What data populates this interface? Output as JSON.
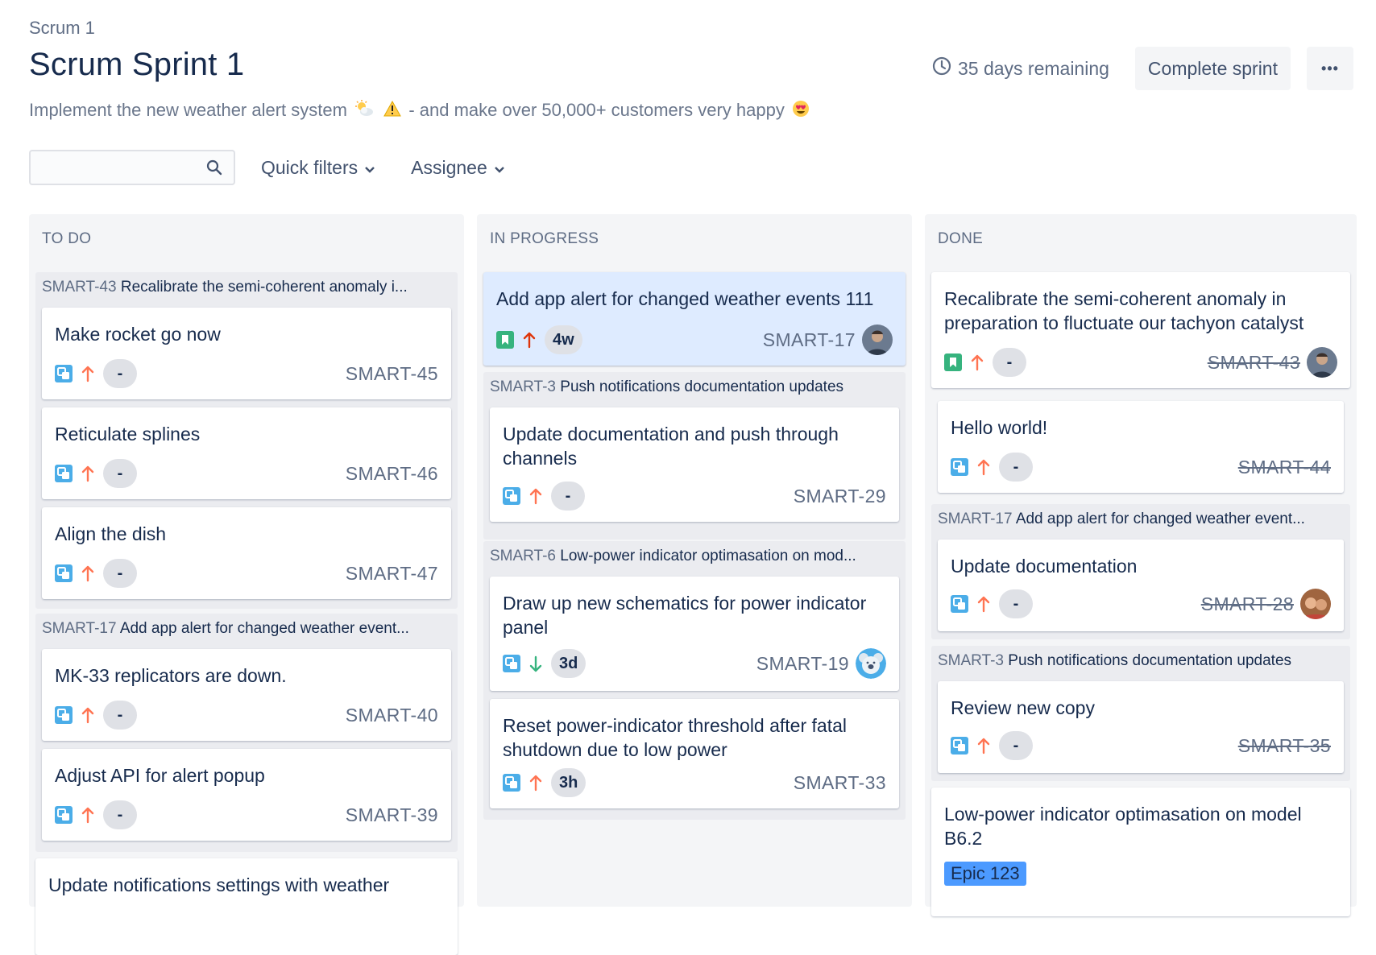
{
  "breadcrumb": "Scrum 1",
  "title": "Scrum Sprint 1",
  "goal": {
    "text_before": "Implement the new weather alert system",
    "text_after": "- and make over 50,000+ customers very happy"
  },
  "header": {
    "days_remaining": "35 days remaining",
    "complete_label": "Complete sprint",
    "more_label": "•••"
  },
  "toolbar": {
    "search_placeholder": "",
    "quick_filters": "Quick filters",
    "assignee": "Assignee"
  },
  "colors": {
    "accent": "#0052cc",
    "story": "#36b37e",
    "task": "#4bade8",
    "high": "#ff7452",
    "highest": "#de350b",
    "low": "#36b37e",
    "selected": "#deebff"
  },
  "columns": {
    "todo": {
      "title": "TO DO",
      "swim1": {
        "key": "SMART-43",
        "summary": "Recalibrate the semi-coherent anomaly i..."
      },
      "c1": {
        "summary": "Make rocket go now",
        "estimate": "-",
        "key": "SMART-45"
      },
      "c2": {
        "summary": "Reticulate splines",
        "estimate": "-",
        "key": "SMART-46"
      },
      "c3": {
        "summary": "Align the dish",
        "estimate": "-",
        "key": "SMART-47"
      },
      "swim2": {
        "key": "SMART-17",
        "summary": "Add app alert for changed weather event..."
      },
      "c4": {
        "summary": "MK-33 replicators are down.",
        "estimate": "-",
        "key": "SMART-40"
      },
      "c5": {
        "summary": "Adjust API for alert popup",
        "estimate": "-",
        "key": "SMART-39"
      },
      "c6": {
        "summary": "Update notifications settings with weather"
      }
    },
    "inprogress": {
      "title": "IN PROGRESS",
      "c1": {
        "summary": "Add app alert for changed weather events 111",
        "estimate": "4w",
        "key": "SMART-17"
      },
      "swim1": {
        "key": "SMART-3",
        "summary": "Push notifications documentation updates"
      },
      "c2": {
        "summary": "Update documentation and push through channels",
        "estimate": "-",
        "key": "SMART-29"
      },
      "swim2": {
        "key": "SMART-6",
        "summary": "Low-power indicator optimasation on mod..."
      },
      "c3": {
        "summary": "Draw up new schematics for power indicator panel",
        "estimate": "3d",
        "key": "SMART-19"
      },
      "c4": {
        "summary": "Reset power-indicator threshold after fatal shutdown due to low power",
        "estimate": "3h",
        "key": "SMART-33"
      }
    },
    "done": {
      "title": "DONE",
      "c1": {
        "summary": "Recalibrate the semi-coherent anomaly in preparation to fluctuate our tachyon catalyst",
        "estimate": "-",
        "key": "SMART-43"
      },
      "c2": {
        "summary": "Hello world!",
        "estimate": "-",
        "key": "SMART-44"
      },
      "swim1": {
        "key": "SMART-17",
        "summary": "Add app alert for changed weather event..."
      },
      "c3": {
        "summary": "Update documentation",
        "estimate": "-",
        "key": "SMART-28"
      },
      "swim2": {
        "key": "SMART-3",
        "summary": "Push notifications documentation updates"
      },
      "c4": {
        "summary": "Review new copy",
        "estimate": "-",
        "key": "SMART-35"
      },
      "c5": {
        "summary": "Low-power indicator optimasation on model B6.2",
        "epic": "Epic 123"
      }
    }
  }
}
